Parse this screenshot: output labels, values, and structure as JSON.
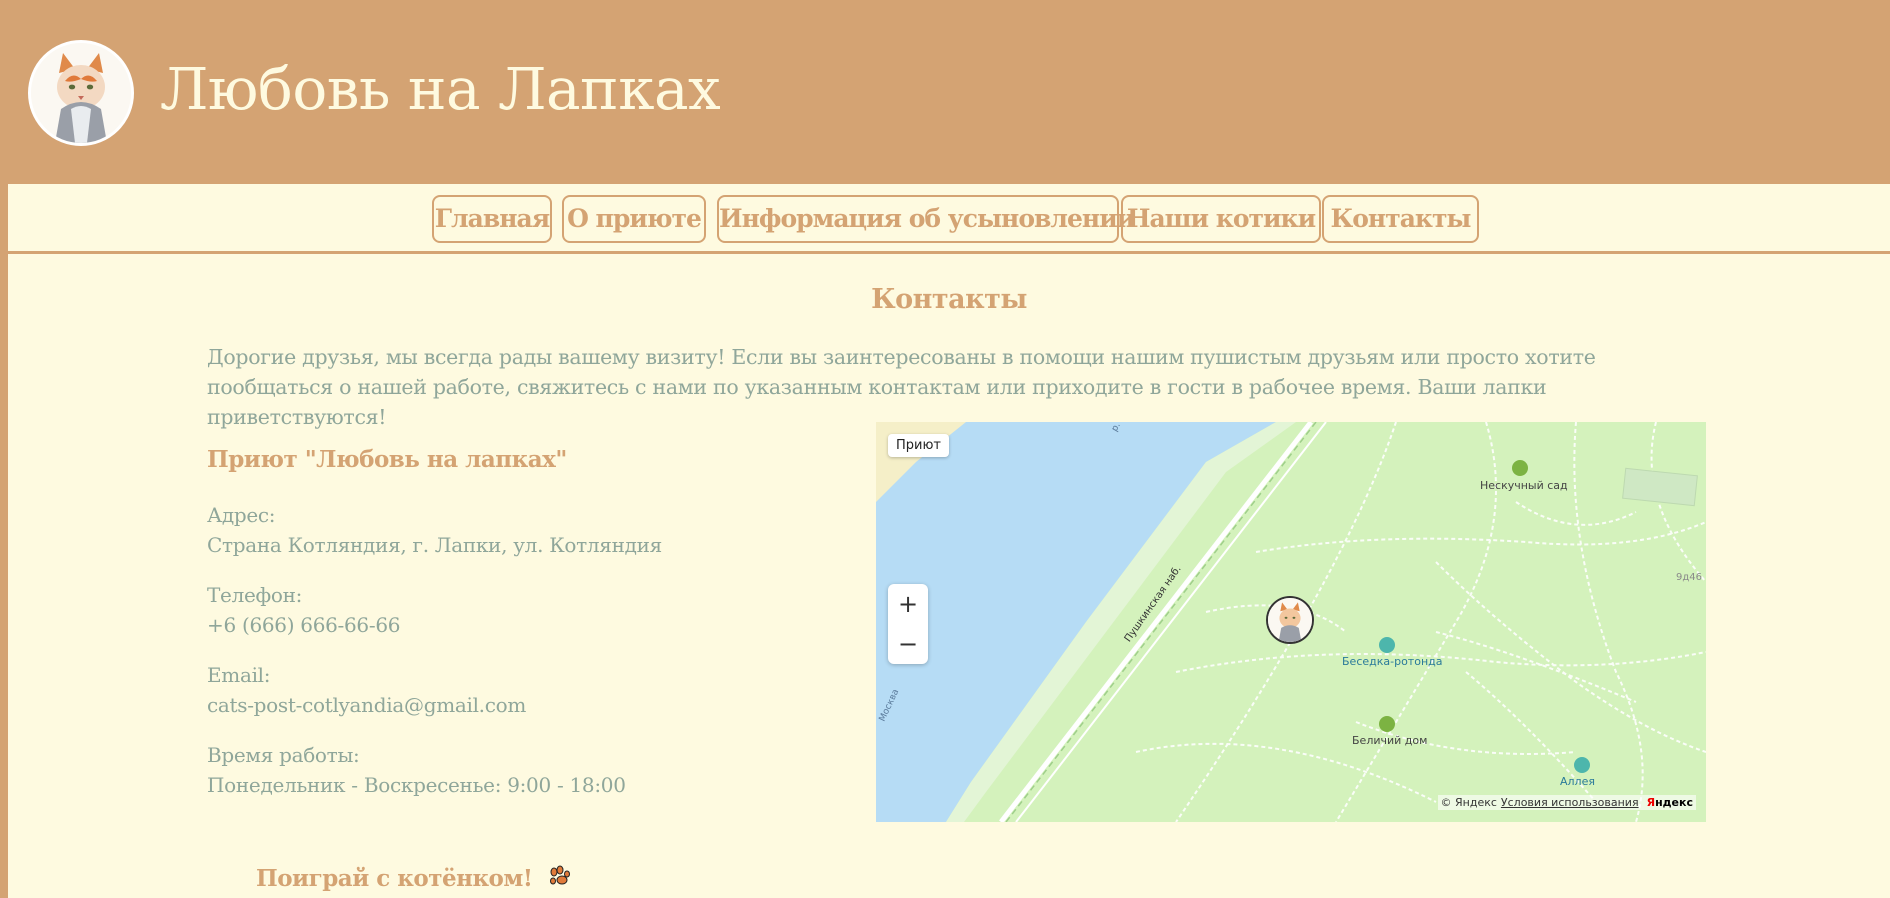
{
  "header": {
    "title": "Любовь на Лапках",
    "logo_icon": "cat-logo-icon"
  },
  "nav": {
    "items": [
      "Главная",
      "О приюте",
      "Информация об усыновлении",
      "Наши котики",
      "Контакты"
    ]
  },
  "contacts": {
    "title": "Контакты",
    "intro": "Дорогие друзья, мы всегда рады вашему визиту! Если вы заинтересованы в помощи нашим пушистым друзьям или просто хотите пообщаться о нашей работе, свяжитесь с нами по указанным контактам или приходите в гости в рабочее время. Ваши лапки приветствуются!",
    "shelter_name": "Приют \"Любовь на лапках\"",
    "address_label": "Адрес:",
    "address_value": "Страна Котляндия, г. Лапки, ул. Котляндия",
    "phone_label": "Телефон:",
    "phone_value": "+6 (666) 666-66-66",
    "email_label": "Email:",
    "email_value": "cats-post-cotlyandia@gmail.com",
    "hours_label": "Время работы:",
    "hours_value": "Понедельник - Воскресенье: 9:00 - 18:00"
  },
  "map": {
    "label": "Приют",
    "zoom_in": "+",
    "zoom_out": "−",
    "street": "Пушкинская наб.",
    "poi_garden": "Нескучный сад",
    "poi_rotunda": "Беседка-ротонда",
    "poi_squirrel": "Беличий дом",
    "poi_alley": "Аллея",
    "house_number": "9д46",
    "river_label": "р.",
    "river_label_2": "Москва",
    "copyright": "© Яндекс",
    "terms": "Условия использования",
    "brand_ya": "Я",
    "brand_rest": "ндекс"
  },
  "game": {
    "title": "Поиграй с котёнком!",
    "icon": "paw-icon"
  },
  "colors": {
    "accent": "#d4a373",
    "background": "#fefae0",
    "text": "#8fa69a"
  }
}
